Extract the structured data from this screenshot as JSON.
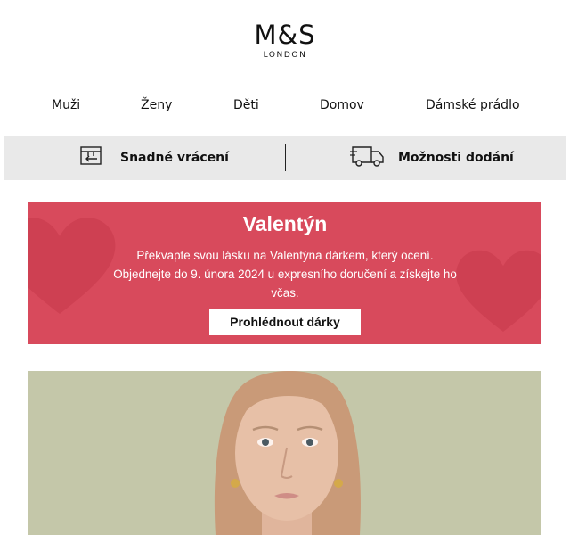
{
  "brand": {
    "name": "M&S",
    "sub": "LONDON"
  },
  "nav": {
    "items": [
      {
        "label": "Muži"
      },
      {
        "label": "Ženy"
      },
      {
        "label": "Děti"
      },
      {
        "label": "Domov"
      },
      {
        "label": "Dámské prádlo"
      }
    ]
  },
  "services": {
    "returns_label": "Snadné vrácení",
    "returns_icon": "return-box-icon",
    "delivery_label": "Možnosti dodání",
    "delivery_icon": "delivery-truck-icon"
  },
  "promo": {
    "title": "Valentýn",
    "text": "Překvapte svou lásku na Valentýna dárkem, který ocení. Objednejte do 9. února 2024 u expresního doručení a získejte ho včas.",
    "button": "Prohlédnout dárky",
    "background_color": "#d84a5c"
  },
  "hero": {
    "image": "woman-portrait"
  }
}
